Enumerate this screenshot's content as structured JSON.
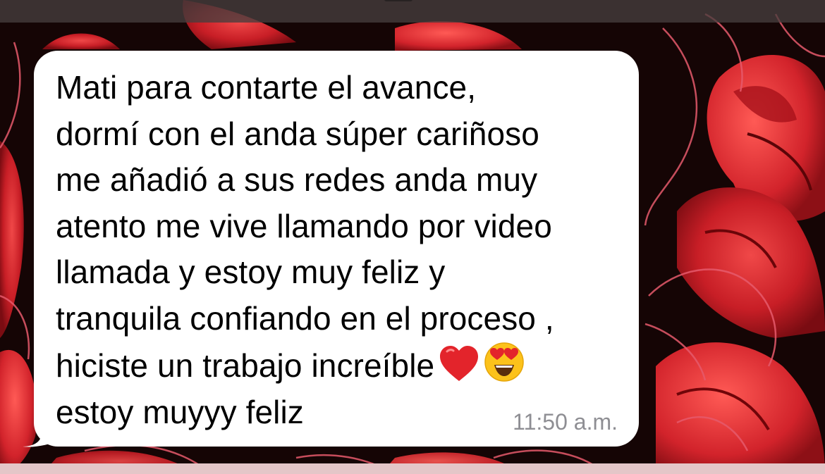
{
  "message": {
    "lines": [
      "Mati para contarte el avance,",
      "dormí con el anda súper cariñoso",
      "me añadió a sus redes anda muy",
      "atento me vive llamando por video",
      "llamada y estoy muy feliz y",
      "tranquila confiando en el proceso ,",
      "hiciste un trabajo increíble",
      "estoy muyyy feliz"
    ],
    "time": "11:50 a.m.",
    "emojis": [
      "heart-emoji",
      "heart-eyes-emoji"
    ]
  },
  "colors": {
    "bubble": "#ffffff",
    "text": "#000000",
    "time": "#8e8e93",
    "wallpaper_base": "#120404",
    "flower_red": "#d7262b",
    "flower_outline": "#e8566a"
  }
}
